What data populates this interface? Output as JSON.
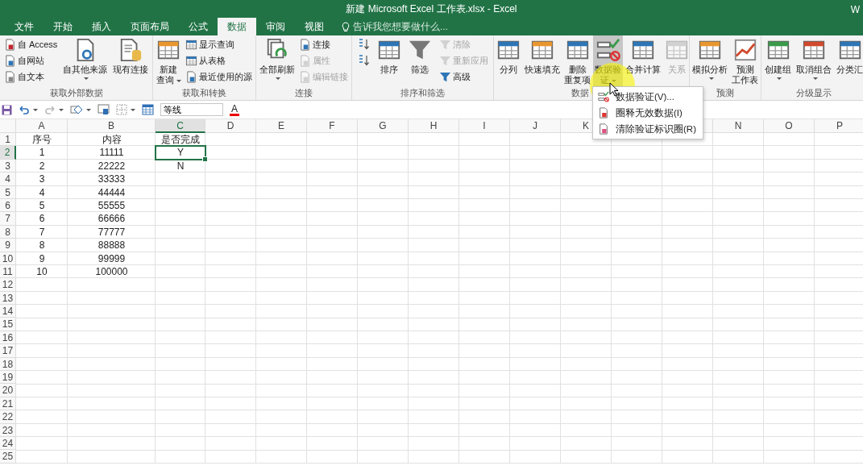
{
  "window": {
    "title": "新建 Microsoft Excel 工作表.xlsx - Excel",
    "user": "W"
  },
  "tabs": [
    {
      "label": "文件",
      "selected": false
    },
    {
      "label": "开始",
      "selected": false
    },
    {
      "label": "插入",
      "selected": false
    },
    {
      "label": "页面布局",
      "selected": false
    },
    {
      "label": "公式",
      "selected": false
    },
    {
      "label": "数据",
      "selected": true
    },
    {
      "label": "审阅",
      "selected": false
    },
    {
      "label": "视图",
      "selected": false
    }
  ],
  "tell_me": {
    "placeholder": "告诉我您想要做什么..."
  },
  "ribbon_groups": [
    {
      "label": "获取外部数据",
      "items": [
        {
          "kind": "small",
          "lines": [
            "自 Access"
          ],
          "disabled": false
        },
        {
          "kind": "small",
          "lines": [
            "自网站"
          ],
          "disabled": false
        },
        {
          "kind": "small",
          "lines": [
            "自文本"
          ],
          "disabled": false
        },
        {
          "kind": "large",
          "lines": [
            "自其他来源"
          ],
          "dropdown": true,
          "disabled": false,
          "pressed": false
        },
        {
          "kind": "large",
          "lines": [
            "现有连接"
          ],
          "dropdown": false,
          "disabled": false,
          "pressed": false
        }
      ]
    },
    {
      "label": "获取和转换",
      "items": [
        {
          "kind": "large",
          "lines": [
            "新建",
            "查询"
          ],
          "dropdown": true,
          "disabled": false,
          "pressed": false
        },
        {
          "kind": "small",
          "lines": [
            "显示查询"
          ],
          "disabled": false
        },
        {
          "kind": "small",
          "lines": [
            "从表格"
          ],
          "disabled": false
        },
        {
          "kind": "small",
          "lines": [
            "最近使用的源"
          ],
          "disabled": false
        }
      ]
    },
    {
      "label": "连接",
      "items": [
        {
          "kind": "large",
          "lines": [
            "全部刷新"
          ],
          "dropdown": true,
          "disabled": false,
          "pressed": false
        },
        {
          "kind": "small",
          "lines": [
            "连接"
          ],
          "disabled": false
        },
        {
          "kind": "small",
          "lines": [
            "属性"
          ],
          "disabled": true
        },
        {
          "kind": "small",
          "lines": [
            "编辑链接"
          ],
          "disabled": true
        }
      ]
    },
    {
      "label": "排序和筛选",
      "items": [
        {
          "kind": "icon",
          "disabled": false
        },
        {
          "kind": "icon",
          "disabled": false
        },
        {
          "kind": "large",
          "lines": [
            "排序"
          ],
          "dropdown": false,
          "disabled": false,
          "pressed": false
        },
        {
          "kind": "large",
          "lines": [
            "筛选"
          ],
          "dropdown": false,
          "disabled": false,
          "pressed": false
        },
        {
          "kind": "small",
          "lines": [
            "清除"
          ],
          "disabled": true
        },
        {
          "kind": "small",
          "lines": [
            "重新应用"
          ],
          "disabled": true
        },
        {
          "kind": "small",
          "lines": [
            "高级"
          ],
          "disabled": false
        }
      ]
    },
    {
      "label": "数据",
      "items": [
        {
          "kind": "large",
          "lines": [
            "分列"
          ],
          "dropdown": false,
          "disabled": false,
          "pressed": false
        },
        {
          "kind": "large",
          "lines": [
            "快速填充"
          ],
          "dropdown": false,
          "disabled": false,
          "pressed": false
        },
        {
          "kind": "large",
          "lines": [
            "删除",
            "重复项"
          ],
          "dropdown": false,
          "disabled": false,
          "pressed": false
        },
        {
          "kind": "large",
          "lines": [
            "数据验",
            "证"
          ],
          "dropdown": true,
          "disabled": false,
          "pressed": true
        },
        {
          "kind": "large",
          "lines": [
            "合并计算"
          ],
          "dropdown": false,
          "disabled": false,
          "pressed": false
        },
        {
          "kind": "large",
          "lines": [
            "关系"
          ],
          "dropdown": false,
          "disabled": true,
          "pressed": false
        }
      ]
    },
    {
      "label": "预测",
      "items": [
        {
          "kind": "large",
          "lines": [
            "模拟分析"
          ],
          "dropdown": true,
          "disabled": false,
          "pressed": false
        },
        {
          "kind": "large",
          "lines": [
            "预测",
            "工作表"
          ],
          "dropdown": false,
          "disabled": false,
          "pressed": false
        }
      ]
    },
    {
      "label": "分级显示",
      "items": [
        {
          "kind": "large",
          "lines": [
            "创建组"
          ],
          "dropdown": true,
          "disabled": false,
          "pressed": false
        },
        {
          "kind": "large",
          "lines": [
            "取消组合"
          ],
          "dropdown": true,
          "disabled": false,
          "pressed": false
        },
        {
          "kind": "large",
          "lines": [
            "分类汇"
          ],
          "dropdown": false,
          "disabled": false,
          "pressed": false
        }
      ]
    }
  ],
  "toolbar": {
    "font_field": {
      "value": "等线"
    },
    "font_color": {
      "label": "A"
    }
  },
  "sheet": {
    "columns": [
      {
        "label": "A",
        "selected": false
      },
      {
        "label": "B",
        "selected": false
      },
      {
        "label": "C",
        "selected": true
      },
      {
        "label": "D",
        "selected": false
      },
      {
        "label": "E",
        "selected": false
      },
      {
        "label": "F",
        "selected": false
      },
      {
        "label": "G",
        "selected": false
      },
      {
        "label": "H",
        "selected": false
      },
      {
        "label": "I",
        "selected": false
      },
      {
        "label": "J",
        "selected": false
      },
      {
        "label": "K",
        "selected": false
      },
      {},
      {
        "selected": false
      },
      {
        "label": "N",
        "selected": false
      },
      {
        "label": "O",
        "selected": false
      },
      {
        "label": "P",
        "selected": false
      }
    ],
    "rows": [
      {
        "header": "1",
        "selected": false,
        "cells": [
          "序号",
          "内容",
          "是否完成"
        ]
      },
      {
        "header": "2",
        "selected": true,
        "cells": [
          "1",
          "11111",
          "Y"
        ]
      },
      {
        "header": "3",
        "selected": false,
        "cells": [
          "2",
          "22222",
          "N"
        ]
      },
      {
        "header": "4",
        "selected": false,
        "cells": [
          "3",
          "33333"
        ]
      },
      {
        "header": "5",
        "selected": false,
        "cells": [
          "4",
          "44444"
        ]
      },
      {
        "header": "6",
        "selected": false,
        "cells": [
          "5",
          "55555"
        ]
      },
      {
        "header": "7",
        "selected": false,
        "cells": [
          "6",
          "66666"
        ]
      },
      {
        "header": "8",
        "selected": false,
        "cells": [
          "7",
          "77777"
        ]
      },
      {
        "header": "9",
        "selected": false,
        "cells": [
          "8",
          "88888"
        ]
      },
      {
        "header": "10",
        "selected": false,
        "cells": [
          "9",
          "99999"
        ]
      },
      {
        "header": "11",
        "selected": false,
        "cells": [
          "10",
          "100000"
        ]
      },
      {
        "header": "12",
        "selected": false
      },
      {
        "header": "13",
        "selected": false
      },
      {
        "header": "14",
        "selected": false
      },
      {
        "header": "15",
        "selected": false
      },
      {
        "header": "16",
        "selected": false
      },
      {
        "header": "17",
        "selected": false
      },
      {
        "header": "18",
        "selected": false
      },
      {
        "header": "19",
        "selected": false
      },
      {
        "header": "20",
        "selected": false
      },
      {
        "header": "21",
        "selected": false
      },
      {
        "header": "22",
        "selected": false
      },
      {
        "header": "23",
        "selected": false
      },
      {
        "header": "24",
        "selected": false
      },
      {
        "header": "25",
        "selected": false
      }
    ]
  },
  "menu": {
    "items": [
      {
        "label": "数据验证(V)..."
      },
      {
        "label": "圈释无效数据(I)"
      },
      {
        "label": "清除验证标识圈(R)"
      }
    ]
  }
}
